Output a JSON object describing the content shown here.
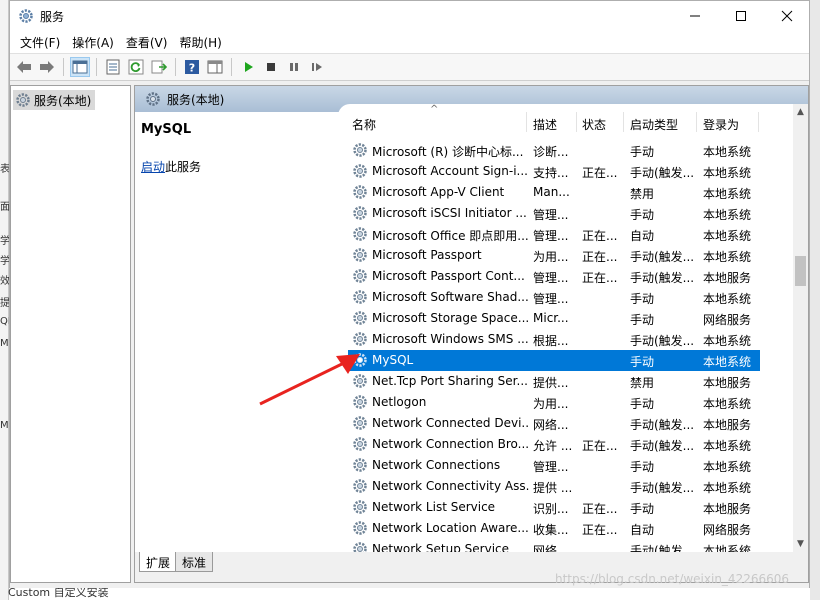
{
  "window": {
    "title": "服务"
  },
  "menu": [
    "文件(F)",
    "操作(A)",
    "查看(V)",
    "帮助(H)"
  ],
  "tree": {
    "item": "服务(本地)"
  },
  "main": {
    "header": "服务(本地)",
    "selected_service": "MySQL",
    "start_link": "启动",
    "start_suffix": "此服务"
  },
  "columns": {
    "name": "名称",
    "desc": "描述",
    "status": "状态",
    "startup": "启动类型",
    "logon": "登录为"
  },
  "services": [
    {
      "name": "Microsoft (R) 诊断中心标...",
      "desc": "诊断...",
      "status": "",
      "startup": "手动",
      "logon": "本地系统"
    },
    {
      "name": "Microsoft Account Sign-i...",
      "desc": "支持...",
      "status": "正在...",
      "startup": "手动(触发...",
      "logon": "本地系统"
    },
    {
      "name": "Microsoft App-V Client",
      "desc": "Man...",
      "status": "",
      "startup": "禁用",
      "logon": "本地系统"
    },
    {
      "name": "Microsoft iSCSI Initiator ...",
      "desc": "管理...",
      "status": "",
      "startup": "手动",
      "logon": "本地系统"
    },
    {
      "name": "Microsoft Office 即点即用...",
      "desc": "管理...",
      "status": "正在...",
      "startup": "自动",
      "logon": "本地系统"
    },
    {
      "name": "Microsoft Passport",
      "desc": "为用...",
      "status": "正在...",
      "startup": "手动(触发...",
      "logon": "本地系统"
    },
    {
      "name": "Microsoft Passport Cont...",
      "desc": "管理...",
      "status": "正在...",
      "startup": "手动(触发...",
      "logon": "本地服务"
    },
    {
      "name": "Microsoft Software Shad...",
      "desc": "管理...",
      "status": "",
      "startup": "手动",
      "logon": "本地系统"
    },
    {
      "name": "Microsoft Storage Space...",
      "desc": "Micr...",
      "status": "",
      "startup": "手动",
      "logon": "网络服务"
    },
    {
      "name": "Microsoft Windows SMS ...",
      "desc": "根据...",
      "status": "",
      "startup": "手动(触发...",
      "logon": "本地系统"
    },
    {
      "name": "MySQL",
      "desc": "",
      "status": "",
      "startup": "手动",
      "logon": "本地系统",
      "selected": true
    },
    {
      "name": "Net.Tcp Port Sharing Ser...",
      "desc": "提供...",
      "status": "",
      "startup": "禁用",
      "logon": "本地服务"
    },
    {
      "name": "Netlogon",
      "desc": "为用...",
      "status": "",
      "startup": "手动",
      "logon": "本地系统"
    },
    {
      "name": "Network Connected Devi...",
      "desc": "网络...",
      "status": "",
      "startup": "手动(触发...",
      "logon": "本地服务"
    },
    {
      "name": "Network Connection Bro...",
      "desc": "允许 ...",
      "status": "正在...",
      "startup": "手动(触发...",
      "logon": "本地系统"
    },
    {
      "name": "Network Connections",
      "desc": "管理...",
      "status": "",
      "startup": "手动",
      "logon": "本地系统"
    },
    {
      "name": "Network Connectivity Ass...",
      "desc": "提供 ...",
      "status": "",
      "startup": "手动(触发...",
      "logon": "本地系统"
    },
    {
      "name": "Network List Service",
      "desc": "识别...",
      "status": "正在...",
      "startup": "手动",
      "logon": "本地服务"
    },
    {
      "name": "Network Location Aware...",
      "desc": "收集...",
      "status": "正在...",
      "startup": "自动",
      "logon": "网络服务"
    },
    {
      "name": "Network Setup Service",
      "desc": "网络...",
      "status": "",
      "startup": "手动(触发...",
      "logon": "本地系统"
    }
  ],
  "tabs": [
    "扩展",
    "标准"
  ],
  "background": {
    "left_chars": [
      "表",
      "面",
      "学",
      "学",
      "效",
      "提",
      "QL",
      "M",
      "M"
    ],
    "bottom_text": "Custom 自定义安装"
  },
  "watermark": "https://blog.csdn.net/weixin_42266606",
  "colors": {
    "selection": "#0078d7",
    "header_gradient": "#b3c6da",
    "link": "#0645ad"
  }
}
